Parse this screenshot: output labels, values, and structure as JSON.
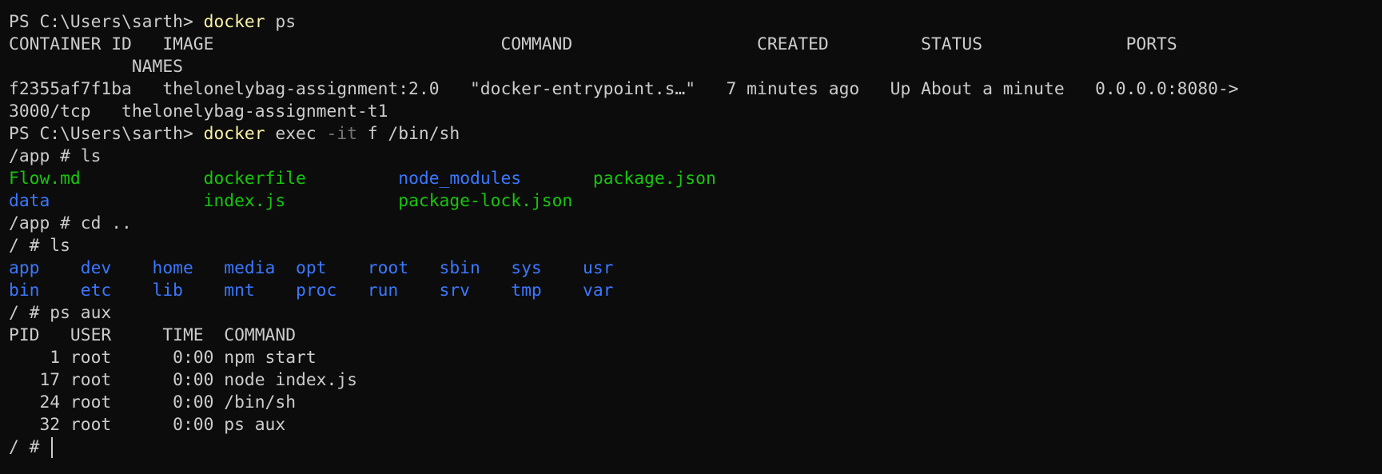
{
  "lines": [
    [
      {
        "t": "PS C:\\Users\\sarth> ",
        "c": "default"
      },
      {
        "t": "docker",
        "c": "cmd"
      },
      {
        "t": " ps",
        "c": "default"
      }
    ],
    [
      {
        "t": "CONTAINER ID   IMAGE                            COMMAND                  CREATED         STATUS              PORTS",
        "c": "default"
      }
    ],
    [
      {
        "t": "            NAMES",
        "c": "default"
      }
    ],
    [
      {
        "t": "f2355af7f1ba   thelonelybag-assignment:2.0   \"docker-entrypoint.s…\"   7 minutes ago   Up About a minute   0.0.0.0:8080->",
        "c": "default"
      }
    ],
    [
      {
        "t": "3000/tcp   thelonelybag-assignment-t1",
        "c": "default"
      }
    ],
    [
      {
        "t": "PS C:\\Users\\sarth> ",
        "c": "default"
      },
      {
        "t": "docker",
        "c": "cmd"
      },
      {
        "t": " exec ",
        "c": "default"
      },
      {
        "t": "-it",
        "c": "flag"
      },
      {
        "t": " f /bin/sh",
        "c": "default"
      }
    ],
    [
      {
        "t": "/app # ls",
        "c": "default"
      }
    ],
    [
      {
        "t": "Flow.md",
        "c": "green"
      },
      {
        "t": "            ",
        "c": "default"
      },
      {
        "t": "dockerfile",
        "c": "green"
      },
      {
        "t": "         ",
        "c": "default"
      },
      {
        "t": "node_modules",
        "c": "blue"
      },
      {
        "t": "       ",
        "c": "default"
      },
      {
        "t": "package.json",
        "c": "green"
      }
    ],
    [
      {
        "t": "data",
        "c": "blue"
      },
      {
        "t": "               ",
        "c": "default"
      },
      {
        "t": "index.js",
        "c": "green"
      },
      {
        "t": "           ",
        "c": "default"
      },
      {
        "t": "package-lock.json",
        "c": "green"
      }
    ],
    [
      {
        "t": "/app # cd ..",
        "c": "default"
      }
    ],
    [
      {
        "t": "/ # ls",
        "c": "default"
      }
    ],
    [
      {
        "t": "app    dev    home   media  opt    root   sbin   sys    usr",
        "c": "blue"
      }
    ],
    [
      {
        "t": "bin    etc    lib    mnt    proc   run    srv    tmp    var",
        "c": "blue"
      }
    ],
    [
      {
        "t": "/ # ps aux",
        "c": "default"
      }
    ],
    [
      {
        "t": "PID   USER     TIME  COMMAND",
        "c": "default"
      }
    ],
    [
      {
        "t": "    1 root      0:00 npm start",
        "c": "default"
      }
    ],
    [
      {
        "t": "   17 root      0:00 node index.js",
        "c": "default"
      }
    ],
    [
      {
        "t": "   24 root      0:00 /bin/sh",
        "c": "default"
      }
    ],
    [
      {
        "t": "   32 root      0:00 ps aux",
        "c": "default"
      }
    ],
    [
      {
        "t": "/ # ",
        "c": "default"
      }
    ]
  ],
  "colors": {
    "background": "#0c0c0c",
    "default": "#cccccc",
    "cmd": "#f9f1a5",
    "flag": "#767676",
    "green": "#16c60c",
    "blue": "#3b78ff"
  }
}
